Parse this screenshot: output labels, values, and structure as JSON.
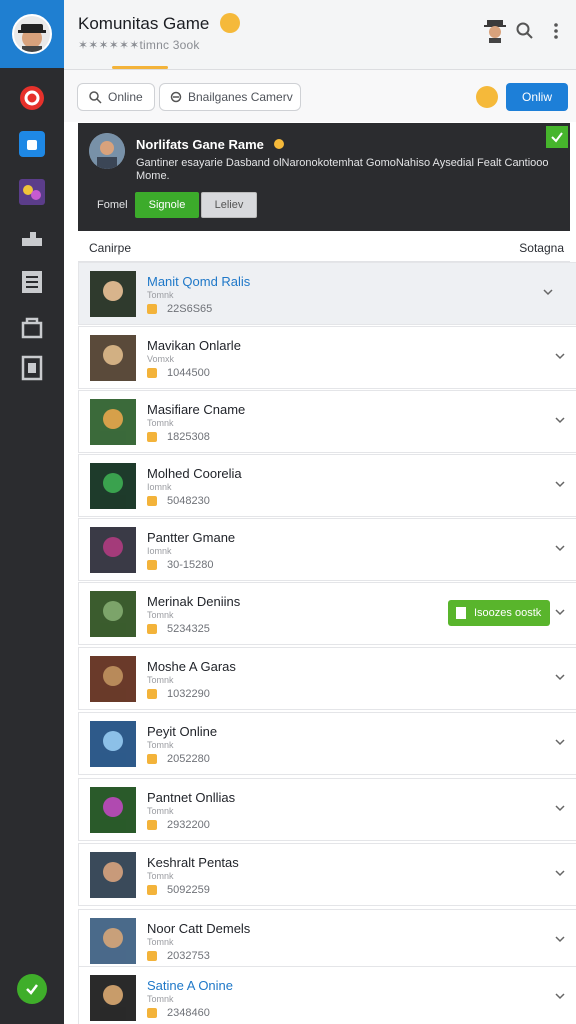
{
  "header": {
    "title": "Komunitas Game",
    "subtitle": "✶✶✶✶✶✶timnc 3ook"
  },
  "filters": {
    "online_label": "Online",
    "games_label": "Bnailganes Camerv",
    "online_button": "Onliw"
  },
  "featured": {
    "title": "Norlifats Gane Rame",
    "description": "Gantiner esayarie Dasband olNaronokotemhat GomoNahiso Aysedial Fealt Cantiooo Mome.",
    "label": "Fomel",
    "signup_label": "Signole",
    "later_label": "Leliev"
  },
  "list": {
    "left_header": "Canirpe",
    "right_header": "Sotagna",
    "items": [
      {
        "title": "Manit Qomd Ralis",
        "sub": "Tomnk",
        "meta": "22S6S65",
        "link": true
      },
      {
        "title": "Mavikan Onlarle",
        "sub": "Vomxk",
        "meta": "1044500",
        "link": false
      },
      {
        "title": "Masifiare Cname",
        "sub": "Tomnk",
        "meta": "1825308",
        "link": false
      },
      {
        "title": "Molhed Coorelia",
        "sub": "Iomnk",
        "meta": "5048230",
        "link": false
      },
      {
        "title": "Pantter Gmane",
        "sub": "Iomnk",
        "meta": "30-15280",
        "link": false
      },
      {
        "title": "Merinak Deniins",
        "sub": "Tomnk",
        "meta": "5234325",
        "link": false,
        "badge": "Isoozes oostk"
      },
      {
        "title": "Moshe A Garas",
        "sub": "Tomnk",
        "meta": "1032290",
        "link": false
      },
      {
        "title": "Peyit Online",
        "sub": "Tomnk",
        "meta": "2052280",
        "link": false
      },
      {
        "title": "Pantnet Onllias",
        "sub": "Tomnk",
        "meta": "2932200",
        "link": false
      },
      {
        "title": "Keshralt Pentas",
        "sub": "Tomnk",
        "meta": "5092259",
        "link": false
      },
      {
        "title": "Noor Catt Demels",
        "sub": "Tomnk",
        "meta": "2032753",
        "link": false
      },
      {
        "title": "Satine A Onine",
        "sub": "Tomnk",
        "meta": "2348460",
        "link": true
      }
    ]
  },
  "colors": {
    "accent_blue": "#1d7fd8",
    "accent_green": "#3cab2b",
    "rail": "#2b2c2f"
  },
  "icons": {
    "rail": [
      "opera-icon",
      "app-store-icon",
      "game-icon",
      "puzzle-icon",
      "notes-icon",
      "lock-icon",
      "document-icon"
    ],
    "status": "check-icon"
  }
}
